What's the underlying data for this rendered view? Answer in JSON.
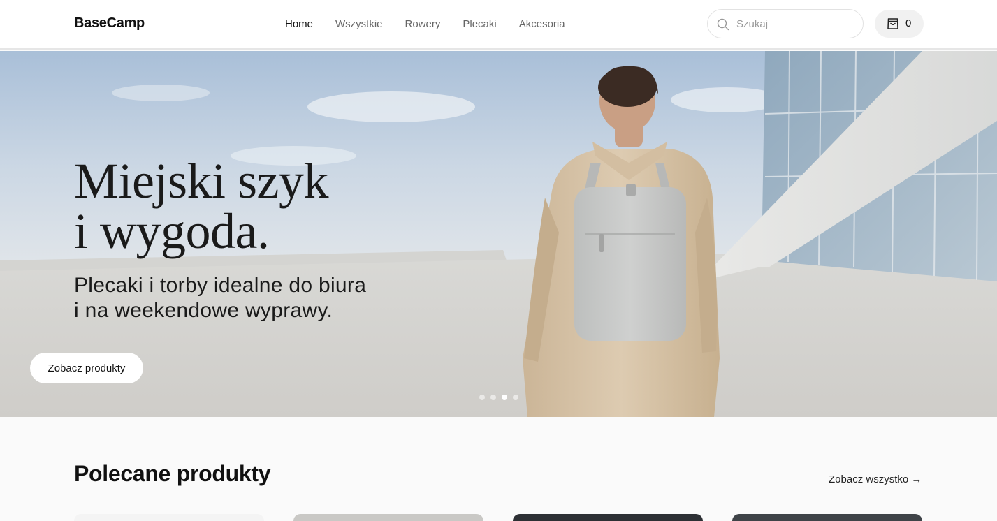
{
  "header": {
    "logo": "BaseCamp",
    "nav": [
      "Home",
      "Wszystkie",
      "Rowery",
      "Plecaki",
      "Akcesoria"
    ],
    "active_nav": "Home",
    "search_placeholder": "Szukaj",
    "cart_count": "0",
    "icons": {
      "search": "search-icon",
      "cart": "shopping-bag-icon"
    }
  },
  "hero": {
    "title": "Miejski szyk\ni wygoda.",
    "subtitle": "Plecaki i torby idealne do biura\ni na weekendowe wyprawy.",
    "cta_label": "Zobacz produkty",
    "slide_count": 4,
    "active_slide": 3
  },
  "featured": {
    "title": "Polecane produkty",
    "see_all_label": "Zobacz wszystko →"
  },
  "colors": {
    "header_bg": "#ffffff",
    "page_bg": "#fafafa",
    "text": "#111111",
    "muted_text": "#666666",
    "sky": "#b9cbe0",
    "coat": "#d8c6ad",
    "backpack": "#c8c9c8"
  }
}
